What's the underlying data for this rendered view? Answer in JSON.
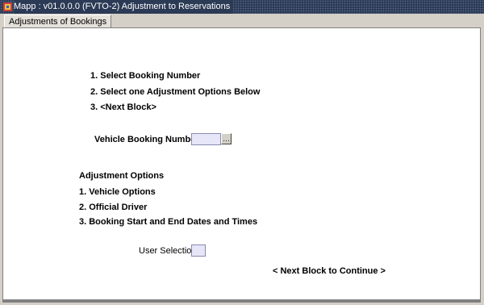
{
  "window": {
    "title": "Mapp : v01.0.0.0 (FVTO-2) Adjustment to Reservations"
  },
  "tabs": [
    {
      "label": "Adjustments of Bookings"
    }
  ],
  "instructions": [
    "1. Select Booking Number",
    "2. Select one Adjustment Options Below",
    "3. <Next Block>"
  ],
  "booking": {
    "label": "Vehicle Booking Number",
    "value": "",
    "lov_label": "…"
  },
  "options": {
    "heading": "Adjustment Options",
    "items": [
      "1. Vehicle Options",
      "2. Official Driver",
      "3. Booking Start and End Dates and Times"
    ]
  },
  "selection": {
    "label": "User Selection",
    "value": ""
  },
  "footer": {
    "next_hint": "< Next Block to Continue >"
  }
}
